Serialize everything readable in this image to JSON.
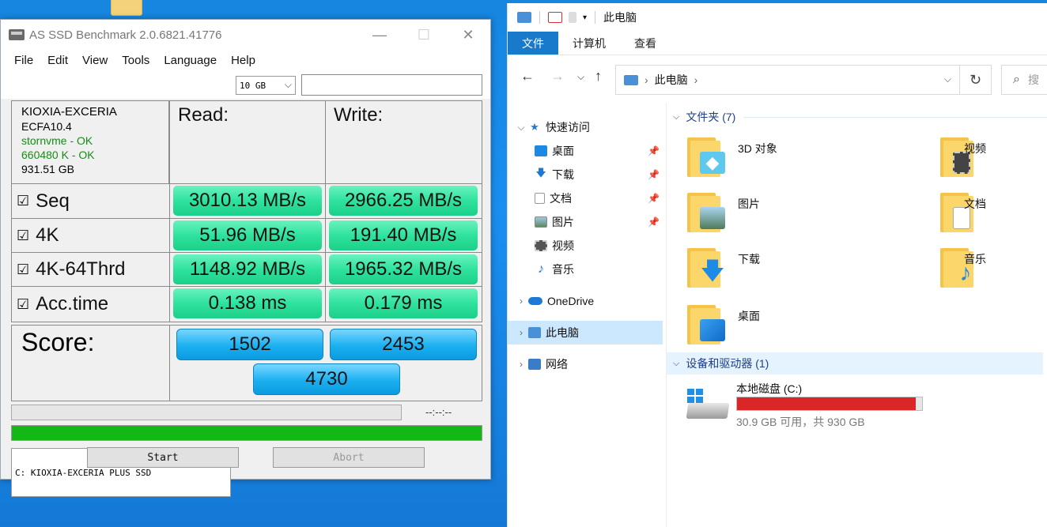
{
  "asssd": {
    "title": "AS SSD Benchmark 2.0.6821.41776",
    "menu": [
      "File",
      "Edit",
      "View",
      "Tools",
      "Language",
      "Help"
    ],
    "drive_select": "C: KIOXIA-EXCERIA PLUS SSD",
    "size_select": "10 GB",
    "info": {
      "model": "KIOXIA-EXCERIA",
      "firmware": "ECFA10.4",
      "driver": "stornvme - OK",
      "alignment": "660480 K - OK",
      "capacity": "931.51 GB"
    },
    "headers": {
      "read": "Read:",
      "write": "Write:"
    },
    "rows": [
      {
        "label": "Seq",
        "read": "3010.13 MB/s",
        "write": "2966.25 MB/s"
      },
      {
        "label": "4K",
        "read": "51.96 MB/s",
        "write": "191.40 MB/s"
      },
      {
        "label": "4K-64Thrd",
        "read": "1148.92 MB/s",
        "write": "1965.32 MB/s"
      },
      {
        "label": "Acc.time",
        "read": "0.138 ms",
        "write": "0.179 ms"
      }
    ],
    "score": {
      "label": "Score:",
      "read": "1502",
      "write": "2453",
      "total": "4730"
    },
    "time": "--:--:--",
    "progress_fraction": 1.0,
    "buttons": {
      "start": "Start",
      "abort": "Abort"
    },
    "checkbox_glyph": "☑"
  },
  "explorer": {
    "qat_title": "此电脑",
    "ribbon_tabs": [
      "文件",
      "计算机",
      "查看"
    ],
    "address": "此电脑",
    "search_glyph": "搜",
    "nav": [
      {
        "label": "快速访问",
        "icon": "star-icon"
      },
      {
        "label": "桌面",
        "icon": "desktop-icon",
        "pinned": true
      },
      {
        "label": "下载",
        "icon": "download-icon",
        "pinned": true
      },
      {
        "label": "文档",
        "icon": "document-icon",
        "pinned": true
      },
      {
        "label": "图片",
        "icon": "picture-icon",
        "pinned": true
      },
      {
        "label": "视频",
        "icon": "video-icon"
      },
      {
        "label": "音乐",
        "icon": "music-icon"
      },
      {
        "label": "OneDrive",
        "icon": "onedrive-icon"
      },
      {
        "label": "此电脑",
        "icon": "pc-icon"
      },
      {
        "label": "网络",
        "icon": "network-icon"
      }
    ],
    "folders_header": "文件夹 (7)",
    "folders": [
      {
        "name": "3D 对象",
        "icon": "3d-objects-icon"
      },
      {
        "name": "视频",
        "icon": "video-folder-icon"
      },
      {
        "name": "图片",
        "icon": "picture-folder-icon"
      },
      {
        "name": "文档",
        "icon": "document-folder-icon"
      },
      {
        "name": "下载",
        "icon": "download-folder-icon"
      },
      {
        "name": "音乐",
        "icon": "music-folder-icon"
      },
      {
        "name": "桌面",
        "icon": "desktop-folder-icon"
      }
    ],
    "devices_header": "设备和驱动器 (1)",
    "drive": {
      "name": "本地磁盘 (C:)",
      "info": "30.9 GB 可用，共 930 GB",
      "used_fraction": 0.967,
      "bar_color": "#da2626"
    }
  }
}
